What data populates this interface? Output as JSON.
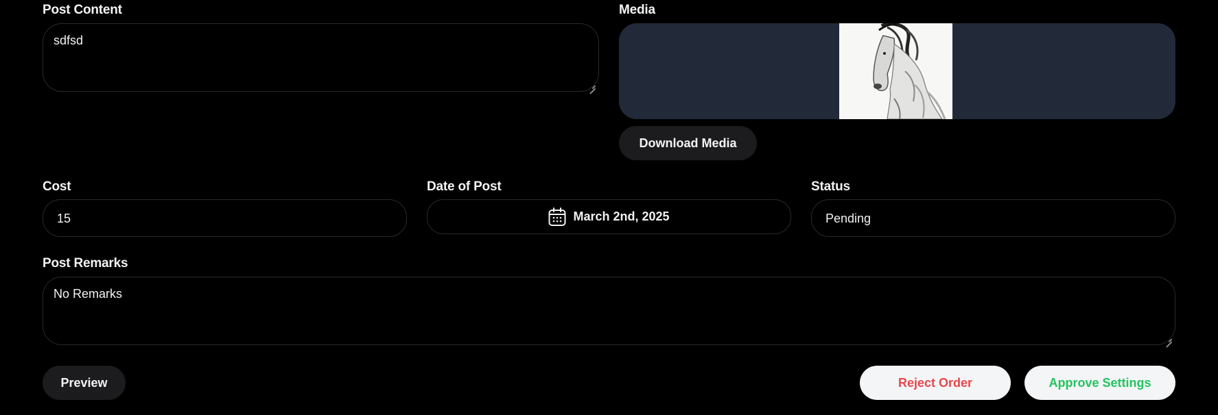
{
  "post_content": {
    "label": "Post Content",
    "value": "sdfsd"
  },
  "media": {
    "label": "Media",
    "image_alt": "horse sketch",
    "download_label": "Download Media"
  },
  "cost": {
    "label": "Cost",
    "value": "15"
  },
  "date_of_post": {
    "label": "Date of Post",
    "value": "March 2nd, 2025",
    "icon": "calendar-icon"
  },
  "status": {
    "label": "Status",
    "value": "Pending"
  },
  "post_remarks": {
    "label": "Post Remarks",
    "value": "No Remarks"
  },
  "actions": {
    "preview_label": "Preview",
    "reject_label": "Reject Order",
    "approve_label": "Approve Settings"
  },
  "colors": {
    "background": "#000000",
    "media_bg": "#222a39",
    "reject_text": "#e5484d",
    "approve_text": "#22c55e",
    "dark_button": "#1c1c1e",
    "light_button": "#f4f5f7"
  }
}
